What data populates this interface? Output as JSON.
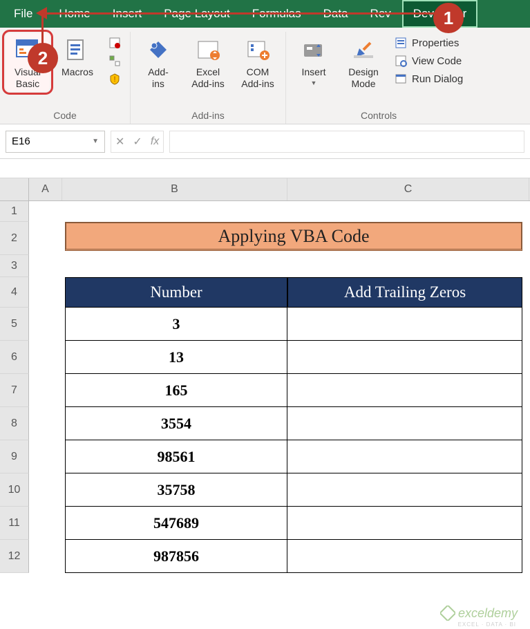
{
  "menu": {
    "file": "File",
    "home": "Home",
    "insert": "Insert",
    "page_layout": "Page Layout",
    "formulas": "Formulas",
    "data": "Data",
    "review": "Rev",
    "developer": "Developer"
  },
  "ribbon": {
    "code": {
      "label": "Code",
      "visual_basic": "Visual\nBasic",
      "macros": "Macros"
    },
    "addins": {
      "label": "Add-ins",
      "addins": "Add-\nins",
      "excel_addins": "Excel\nAdd-ins",
      "com_addins": "COM\nAdd-ins"
    },
    "controls": {
      "label": "Controls",
      "insert": "Insert",
      "design_mode": "Design\nMode",
      "properties": "Properties",
      "view_code": "View Code",
      "run_dialog": "Run Dialog"
    }
  },
  "namebox": "E16",
  "fx": "fx",
  "sheet": {
    "col_a": "A",
    "col_b": "B",
    "col_c": "C",
    "rows": [
      "1",
      "2",
      "3",
      "4",
      "5",
      "6",
      "7",
      "8",
      "9",
      "10",
      "11",
      "12"
    ],
    "title": "Applying VBA Code",
    "hdr_number": "Number",
    "hdr_trailing": "Add Trailing Zeros",
    "numbers": [
      "3",
      "13",
      "165",
      "3554",
      "98561",
      "35758",
      "547689",
      "987856"
    ]
  },
  "callouts": {
    "one": "1",
    "two": "2"
  },
  "watermark": "exceldemy",
  "watermark_sub": "EXCEL · DATA · BI"
}
